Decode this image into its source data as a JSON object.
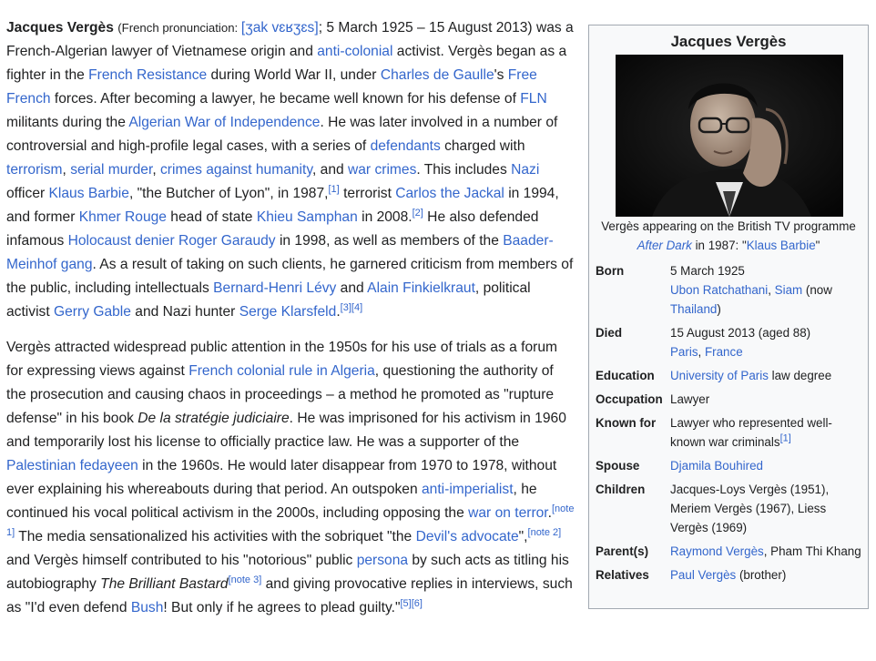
{
  "article": {
    "p1": [
      {
        "t": "Jacques Vergès",
        "b": true
      },
      {
        "t": " "
      },
      {
        "t": "(French pronunciation: ",
        "s": true
      },
      {
        "t": "[ʒak vɛʁʒɛs]",
        "l": true
      },
      {
        "t": "; 5 March 1925 – 15 August 2013) was a French-Algerian lawyer of Vietnamese origin and "
      },
      {
        "t": "anti-colonial",
        "l": true
      },
      {
        "t": " activist. Vergès began as a fighter in the "
      },
      {
        "t": "French Resistance",
        "l": true
      },
      {
        "t": " during World War II, under "
      },
      {
        "t": "Charles de Gaulle",
        "l": true
      },
      {
        "t": "'s "
      },
      {
        "t": "Free French",
        "l": true
      },
      {
        "t": " forces. After becoming a lawyer, he became well known for his defense of "
      },
      {
        "t": "FLN",
        "l": true
      },
      {
        "t": " militants during the "
      },
      {
        "t": "Algerian War of Independence",
        "l": true
      },
      {
        "t": ". He was later involved in a number of controversial and high-profile legal cases, with a series of "
      },
      {
        "t": "defendants",
        "l": true
      },
      {
        "t": " charged with "
      },
      {
        "t": "terrorism",
        "l": true
      },
      {
        "t": ", "
      },
      {
        "t": "serial murder",
        "l": true
      },
      {
        "t": ", "
      },
      {
        "t": "crimes against humanity",
        "l": true
      },
      {
        "t": ", and "
      },
      {
        "t": "war crimes",
        "l": true
      },
      {
        "t": ". This includes "
      },
      {
        "t": "Nazi",
        "l": true
      },
      {
        "t": " officer "
      },
      {
        "t": "Klaus Barbie",
        "l": true
      },
      {
        "t": ", \"the Butcher of Lyon\", in 1987,"
      },
      {
        "t": "[1]",
        "sup": true
      },
      {
        "t": " terrorist "
      },
      {
        "t": "Carlos the Jackal",
        "l": true
      },
      {
        "t": " in 1994, and former "
      },
      {
        "t": "Khmer Rouge",
        "l": true
      },
      {
        "t": " head of state "
      },
      {
        "t": "Khieu Samphan",
        "l": true
      },
      {
        "t": " in 2008."
      },
      {
        "t": "[2]",
        "sup": true
      },
      {
        "t": " He also defended infamous "
      },
      {
        "t": "Holocaust denier",
        "l": true
      },
      {
        "t": " "
      },
      {
        "t": "Roger Garaudy",
        "l": true
      },
      {
        "t": " in 1998, as well as members of the "
      },
      {
        "t": "Baader-Meinhof gang",
        "l": true
      },
      {
        "t": ". As a result of taking on such clients, he garnered criticism from members of the public, including intellectuals "
      },
      {
        "t": "Bernard-Henri Lévy",
        "l": true
      },
      {
        "t": " and "
      },
      {
        "t": "Alain Finkielkraut",
        "l": true
      },
      {
        "t": ", political activist "
      },
      {
        "t": "Gerry Gable",
        "l": true
      },
      {
        "t": " and Nazi hunter "
      },
      {
        "t": "Serge Klarsfeld",
        "l": true
      },
      {
        "t": "."
      },
      {
        "t": "[3][4]",
        "sup": true
      }
    ],
    "p2": [
      {
        "t": "Vergès attracted widespread public attention in the 1950s for his use of trials as a forum for expressing views against "
      },
      {
        "t": "French colonial rule in Algeria",
        "l": true
      },
      {
        "t": ", questioning the authority of the prosecution and causing chaos in proceedings – a method he promoted as \"rupture defense\" in his book "
      },
      {
        "t": "De la stratégie judiciaire",
        "i": true
      },
      {
        "t": ". He was imprisoned for his activism in 1960 and temporarily lost his license to officially practice law. He was a supporter of the "
      },
      {
        "t": "Palestinian fedayeen",
        "l": true
      },
      {
        "t": " in the 1960s. He would later disappear from 1970 to 1978, without ever explaining his whereabouts during that period. An outspoken "
      },
      {
        "t": "anti-imperialist",
        "l": true
      },
      {
        "t": ", he continued his vocal political activism in the 2000s, including opposing the "
      },
      {
        "t": "war on terror",
        "l": true
      },
      {
        "t": "."
      },
      {
        "t": "[note 1]",
        "sup": true
      },
      {
        "t": " The media sensationalized his activities with the sobriquet \"the "
      },
      {
        "t": "Devil's advocate",
        "l": true
      },
      {
        "t": "\","
      },
      {
        "t": "[note 2]",
        "sup": true
      },
      {
        "t": " and Vergès himself contributed to his \"notorious\" public "
      },
      {
        "t": "persona",
        "l": true
      },
      {
        "t": " by such acts as titling his autobiography "
      },
      {
        "t": "The Brilliant Bastard",
        "i": true
      },
      {
        "t": "[note 3]",
        "sup": true
      },
      {
        "t": " and giving provocative replies in interviews, such as \"I'd even defend "
      },
      {
        "t": "Bush",
        "l": true
      },
      {
        "t": "! But only if he agrees to plead guilty.\""
      },
      {
        "t": "[5][6]",
        "sup": true
      }
    ]
  },
  "infobox": {
    "title": "Jacques Vergès",
    "caption": [
      {
        "t": "Vergès appearing on the British TV programme "
      },
      {
        "t": "After Dark",
        "l": true,
        "i": true
      },
      {
        "t": " in 1987: \""
      },
      {
        "t": "Klaus Barbie",
        "l": true
      },
      {
        "t": "\""
      }
    ],
    "rows": [
      {
        "label": "Born",
        "value": [
          {
            "t": "5 March 1925"
          },
          {
            "br": true
          },
          {
            "t": "Ubon Ratchathani",
            "l": true
          },
          {
            "t": ", "
          },
          {
            "t": "Siam",
            "l": true
          },
          {
            "t": " (now "
          },
          {
            "t": "Thailand",
            "l": true
          },
          {
            "t": ")"
          }
        ]
      },
      {
        "label": "Died",
        "value": [
          {
            "t": "15 August 2013 (aged 88)"
          },
          {
            "br": true
          },
          {
            "t": "Paris",
            "l": true
          },
          {
            "t": ", "
          },
          {
            "t": "France",
            "l": true
          }
        ]
      },
      {
        "label": "Education",
        "value": [
          {
            "t": "University of Paris",
            "l": true
          },
          {
            "t": " law degree"
          }
        ]
      },
      {
        "label": "Occupation",
        "value": [
          {
            "t": "Lawyer"
          }
        ]
      },
      {
        "label": "Known for",
        "value": [
          {
            "t": "Lawyer who represented well-known war criminals"
          },
          {
            "t": "[1]",
            "sup": true
          }
        ]
      },
      {
        "label": "Spouse",
        "value": [
          {
            "t": "Djamila Bouhired",
            "l": true
          }
        ]
      },
      {
        "label": "Children",
        "value": [
          {
            "t": "Jacques-Loys Vergès (1951), Meriem Vergès (1967), Liess Vergès (1969)"
          }
        ]
      },
      {
        "label": "Parent(s)",
        "value": [
          {
            "t": "Raymond Vergès",
            "l": true
          },
          {
            "t": ", Pham Thi Khang"
          }
        ]
      },
      {
        "label": "Relatives",
        "value": [
          {
            "t": "Paul Vergès",
            "l": true
          },
          {
            "t": " (brother)"
          }
        ]
      }
    ]
  }
}
